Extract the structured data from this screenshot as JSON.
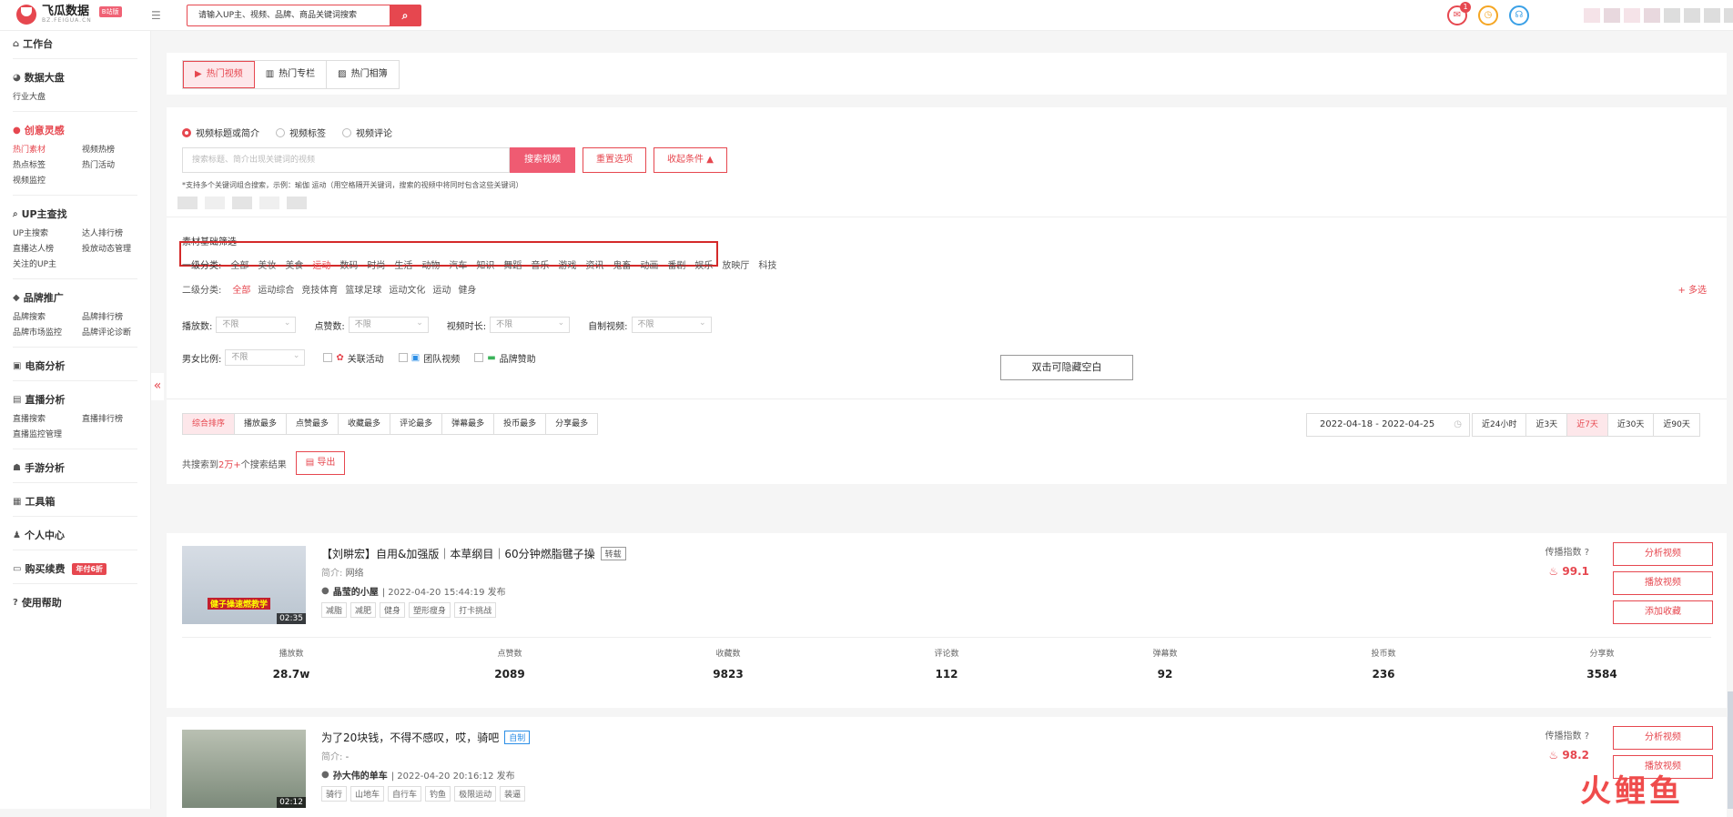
{
  "brand": {
    "name": "飞瓜数据",
    "sub": "BZ.FEIGUA.CN",
    "badge": "B站版"
  },
  "top_search": {
    "placeholder": "请输入UP主、视频、品牌、商品关键词搜索"
  },
  "notifications": {
    "count": "1"
  },
  "sidebar": {
    "workbench": "工作台",
    "dashboard": "数据大盘",
    "dashboard_items": [
      "行业大盘"
    ],
    "creative": "创意灵感",
    "creative_items": [
      "热门素材",
      "视频热榜",
      "热点标签",
      "热门活动",
      "视频监控"
    ],
    "up_search": "UP主查找",
    "up_items": [
      "UP主搜索",
      "达人排行榜",
      "直播达人榜",
      "投放动态管理",
      "关注的UP主"
    ],
    "brand": "品牌推广",
    "brand_items": [
      "品牌搜索",
      "品牌排行榜",
      "品牌市场监控",
      "品牌评论诊断"
    ],
    "ecommerce": "电商分析",
    "live": "直播分析",
    "live_items": [
      "直播搜索",
      "直播排行榜",
      "直播监控管理"
    ],
    "mobile_game": "手游分析",
    "toolbox": "工具箱",
    "personal": "个人中心",
    "renew": "购买续费",
    "renew_badge": "年付6折",
    "help": "使用帮助"
  },
  "tabs": [
    "热门视频",
    "热门专栏",
    "热门相簿"
  ],
  "search_scope": [
    "视频标题或简介",
    "视频标签",
    "视频评论"
  ],
  "search": {
    "placeholder": "搜索标题、简介出现关键词的视频",
    "button": "搜索视频",
    "reset": "重置选项",
    "collapse": "收起条件"
  },
  "hint": "*支持多个关键词组合搜索，示例：瑜伽 运动（用空格隔开关键词，搜索的视频中将同时包含这些关键词）",
  "filter_section_title": "素材基础筛选",
  "category1": {
    "label": "一级分类:",
    "items": [
      "全部",
      "美妆",
      "美食",
      "运动",
      "数码",
      "时尚",
      "生活",
      "动物",
      "汽车",
      "知识",
      "舞蹈",
      "音乐",
      "游戏",
      "资讯",
      "鬼畜",
      "动画",
      "番剧",
      "娱乐",
      "放映厅",
      "科技"
    ],
    "active": "运动"
  },
  "category2": {
    "label": "二级分类:",
    "items": [
      "全部",
      "运动综合",
      "竞技体育",
      "篮球足球",
      "运动文化",
      "运动",
      "健身"
    ],
    "active": "全部",
    "multi": "+ 多选"
  },
  "filters": {
    "play_count": "播放数:",
    "like_count": "点赞数:",
    "duration": "视频时长:",
    "self_made": "自制视频:",
    "gender_ratio": "男女比例:",
    "unlimited": "不限",
    "checkbox_activity": "关联活动",
    "checkbox_team": "团队视频",
    "checkbox_brand": "品牌赞助"
  },
  "tooltip": "双击可隐藏空白",
  "sort_options": [
    "综合排序",
    "播放最多",
    "点赞最多",
    "收藏最多",
    "评论最多",
    "弹幕最多",
    "投币最多",
    "分享最多"
  ],
  "date_range": "2022-04-18 - 2022-04-25",
  "range_options": [
    "近24小时",
    "近3天",
    "近7天",
    "近30天",
    "近90天"
  ],
  "range_active": "近7天",
  "results": {
    "prefix": "共搜索到",
    "count": "2万+",
    "suffix": "个搜索结果",
    "export": "导出"
  },
  "videos": [
    {
      "title": "【刘畊宏】自用&加强版｜本草纲目｜60分钟燃脂毽子操",
      "tag": "转载",
      "intro_label": "简介:",
      "intro": "网络",
      "author": "晶莹的小屋",
      "published": "| 2022-04-20 15:44:19 发布",
      "keywords": [
        "减脂",
        "减肥",
        "健身",
        "塑形瘦身",
        "打卡挑战"
      ],
      "duration": "02:35",
      "caption": "健子操速燃教学",
      "index_label": "传播指数",
      "index_value": "99.1",
      "stats": [
        {
          "label": "播放数",
          "value": "28.7w"
        },
        {
          "label": "点赞数",
          "value": "2089"
        },
        {
          "label": "收藏数",
          "value": "9823"
        },
        {
          "label": "评论数",
          "value": "112"
        },
        {
          "label": "弹幕数",
          "value": "92"
        },
        {
          "label": "投币数",
          "value": "236"
        },
        {
          "label": "分享数",
          "value": "3584"
        }
      ]
    },
    {
      "title": "为了20块钱，不得不感叹，哎，骑吧",
      "tag": "自制",
      "intro_label": "简介:",
      "intro": "-",
      "author": "孙大伟的单车",
      "published": "| 2022-04-20 20:16:12 发布",
      "keywords": [
        "骑行",
        "山地车",
        "自行车",
        "钓鱼",
        "极限运动",
        "装逼"
      ],
      "duration": "02:12",
      "index_label": "传播指数",
      "index_value": "98.2"
    }
  ],
  "video_actions": [
    "分析视频",
    "播放视频",
    "添加收藏"
  ],
  "watermark": "火鲤鱼"
}
